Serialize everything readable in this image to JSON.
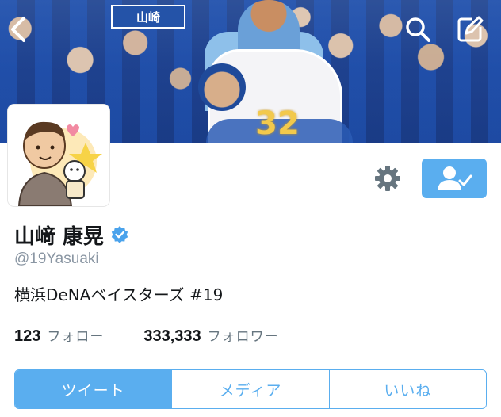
{
  "header": {
    "banner_sign_text": "山崎",
    "banner_number": "32",
    "back_icon": "chevron-left-icon",
    "search_icon": "search-icon",
    "compose_icon": "compose-icon"
  },
  "profile": {
    "display_name": "山﨑 康晃",
    "verified_icon": "verified-badge-icon",
    "handle": "@19Yasuaki",
    "bio": "横浜DeNAベイスターズ #19",
    "following_count": "123",
    "following_label": "フォロー",
    "followers_count": "333,333",
    "followers_label": "フォロワー"
  },
  "actions": {
    "settings_icon": "gear-icon",
    "follow_icon": "user-following-icon"
  },
  "tabs": [
    {
      "label": "ツイート",
      "active": true
    },
    {
      "label": "メディア",
      "active": false
    },
    {
      "label": "いいね",
      "active": false
    }
  ],
  "colors": {
    "accent": "#5aaeef",
    "text": "#14171a",
    "muted": "#8a96a3",
    "verified": "#4ba3ec"
  }
}
